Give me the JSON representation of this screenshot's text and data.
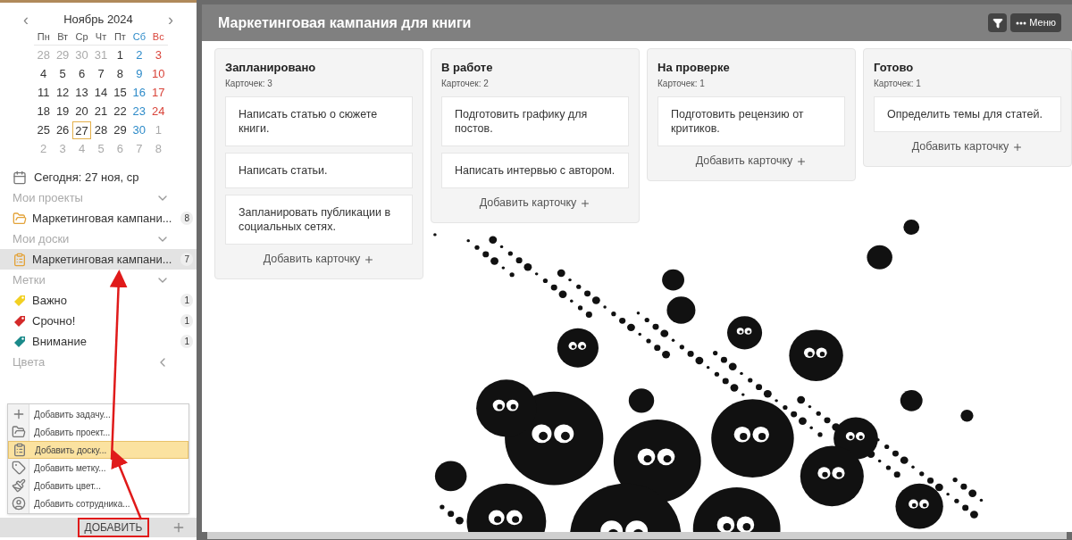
{
  "calendar": {
    "month": "Ноябрь 2024",
    "prev": "‹",
    "next": "›",
    "weekdays": [
      "Пн",
      "Вт",
      "Ср",
      "Чт",
      "Пт",
      "Сб",
      "Вс"
    ],
    "weeks": [
      [
        {
          "day": "28",
          "muted": true,
          "selected": false
        },
        {
          "day": "29",
          "muted": true,
          "selected": false
        },
        {
          "day": "30",
          "muted": true,
          "selected": false
        },
        {
          "day": "31",
          "muted": true,
          "selected": false
        },
        {
          "day": "1",
          "muted": false,
          "selected": false
        },
        {
          "day": "2",
          "muted": false,
          "selected": false
        },
        {
          "day": "3",
          "muted": false,
          "selected": false
        }
      ],
      [
        {
          "day": "4",
          "muted": false,
          "selected": false
        },
        {
          "day": "5",
          "muted": false,
          "selected": false
        },
        {
          "day": "6",
          "muted": false,
          "selected": false
        },
        {
          "day": "7",
          "muted": false,
          "selected": false
        },
        {
          "day": "8",
          "muted": false,
          "selected": false
        },
        {
          "day": "9",
          "muted": false,
          "selected": false
        },
        {
          "day": "10",
          "muted": false,
          "selected": false
        }
      ],
      [
        {
          "day": "11",
          "muted": false,
          "selected": false
        },
        {
          "day": "12",
          "muted": false,
          "selected": false
        },
        {
          "day": "13",
          "muted": false,
          "selected": false
        },
        {
          "day": "14",
          "muted": false,
          "selected": false
        },
        {
          "day": "15",
          "muted": false,
          "selected": false
        },
        {
          "day": "16",
          "muted": false,
          "selected": false
        },
        {
          "day": "17",
          "muted": false,
          "selected": false
        }
      ],
      [
        {
          "day": "18",
          "muted": false,
          "selected": false
        },
        {
          "day": "19",
          "muted": false,
          "selected": false
        },
        {
          "day": "20",
          "muted": false,
          "selected": false
        },
        {
          "day": "21",
          "muted": false,
          "selected": false
        },
        {
          "day": "22",
          "muted": false,
          "selected": false
        },
        {
          "day": "23",
          "muted": false,
          "selected": false
        },
        {
          "day": "24",
          "muted": false,
          "selected": false
        }
      ],
      [
        {
          "day": "25",
          "muted": false,
          "selected": false
        },
        {
          "day": "26",
          "muted": false,
          "selected": false
        },
        {
          "day": "27",
          "muted": false,
          "selected": true
        },
        {
          "day": "28",
          "muted": false,
          "selected": false
        },
        {
          "day": "29",
          "muted": false,
          "selected": false
        },
        {
          "day": "30",
          "muted": false,
          "selected": false
        },
        {
          "day": "1",
          "muted": true,
          "selected": false
        }
      ],
      [
        {
          "day": "2",
          "muted": true,
          "selected": false
        },
        {
          "day": "3",
          "muted": true,
          "selected": false
        },
        {
          "day": "4",
          "muted": true,
          "selected": false
        },
        {
          "day": "5",
          "muted": true,
          "selected": false
        },
        {
          "day": "6",
          "muted": true,
          "selected": false
        },
        {
          "day": "7",
          "muted": true,
          "selected": false
        },
        {
          "day": "8",
          "muted": true,
          "selected": false
        }
      ]
    ]
  },
  "today": "Сегодня: 27 ноя, ср",
  "sections": [
    {
      "title": "Мои проекты",
      "expanded": true,
      "items": [
        {
          "kind": "project",
          "label": "Маркетинговая кампани...",
          "count": "8",
          "selected": false
        }
      ]
    },
    {
      "title": "Мои доски",
      "expanded": true,
      "items": [
        {
          "kind": "board",
          "label": "Маркетинговая кампани...",
          "count": "7",
          "selected": true
        }
      ]
    },
    {
      "title": "Метки",
      "expanded": true,
      "items": [
        {
          "kind": "tag",
          "label": "Важно",
          "count": "1",
          "color": "#f2d022",
          "selected": false
        },
        {
          "kind": "tag",
          "label": "Срочно!",
          "count": "1",
          "color": "#d42a2a",
          "selected": false
        },
        {
          "kind": "tag",
          "label": "Внимание",
          "count": "1",
          "color": "#1a8a8a",
          "selected": false
        }
      ]
    },
    {
      "title": "Цвета",
      "expanded": false
    }
  ],
  "add_menu": [
    {
      "kind": "task",
      "label": "Добавить задачу...",
      "selected": false
    },
    {
      "kind": "project",
      "label": "Добавить проект...",
      "selected": false
    },
    {
      "kind": "board",
      "label": "Добавить доску...",
      "selected": true
    },
    {
      "kind": "tag",
      "label": "Добавить метку...",
      "selected": false
    },
    {
      "kind": "color",
      "label": "Добавить цвет...",
      "selected": false
    },
    {
      "kind": "user",
      "label": "Добавить сотрудника...",
      "selected": false
    }
  ],
  "add_button": "ДОБАВИТЬ",
  "board": {
    "title": "Маркетинговая кампания для книги",
    "menu": "Меню",
    "columns": [
      {
        "title": "Запланировано",
        "count": "Карточек: 3",
        "cards": [
          "Написать статью о сюжете книги.",
          "Написать статьи.",
          "Запланировать публикации в социальных сетях."
        ],
        "add": "Добавить карточку"
      },
      {
        "title": "В работе",
        "count": "Карточек: 2",
        "cards": [
          "Подготовить графику для постов.",
          "Написать интервью с автором."
        ],
        "add": "Добавить карточку"
      },
      {
        "title": "На проверке",
        "count": "Карточек: 1",
        "cards": [
          "Подготовить рецензию от критиков."
        ],
        "add": "Добавить карточку"
      },
      {
        "title": "Готово",
        "count": "Карточек: 1",
        "cards": [
          "Определить темы для статей."
        ],
        "add": "Добавить карточку"
      }
    ]
  }
}
